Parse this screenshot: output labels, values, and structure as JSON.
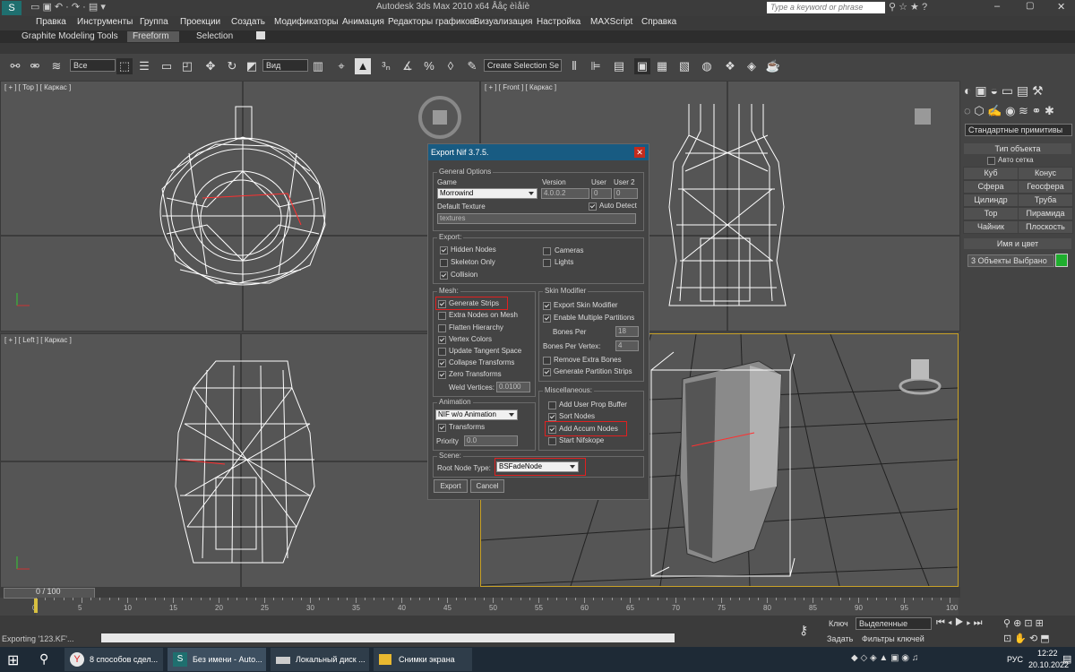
{
  "app": {
    "title": "Autodesk 3ds Max 2010 x64       Ååç èìåíè",
    "search_placeholder": "Type a keyword or phrase"
  },
  "menu": [
    "Правка",
    "Инструменты",
    "Группа",
    "Проекции",
    "Создать",
    "Модификаторы",
    "Анимация",
    "Редакторы графиков",
    "Визуализация",
    "Настройка",
    "MAXScript",
    "Справка"
  ],
  "ribbon_tabs": [
    "Graphite Modeling Tools",
    "Freeform",
    "Selection"
  ],
  "toolbar": {
    "select_filter": "Все",
    "ref_coord": "Вид",
    "selection_set": "Create Selection Se"
  },
  "viewports": {
    "top": "[ + ] [ Top ] [ Каркас ]",
    "front": "[ + ] [ Front ] [ Каркас ]",
    "left": "[ + ] [ Left ] [ Каркас ]"
  },
  "cmd_panel": {
    "category": "Стандартные примитивы",
    "object_type_header": "Тип объекта",
    "autogrid": "Авто сетка",
    "buttons": [
      "Куб",
      "Конус",
      "Сфера",
      "Геосфера",
      "Цилиндр",
      "Труба",
      "Тор",
      "Пирамида",
      "Чайник",
      "Плоскость"
    ],
    "name_header": "Имя и цвет",
    "name_value": "3 Объекты Выбрано"
  },
  "dialog": {
    "title": "Export Nif 3.7.5.",
    "general": {
      "header": "General Options",
      "game_label": "Game",
      "game": "Morrowind",
      "version_label": "Version",
      "version": "4.0.0.2",
      "user_label": "User",
      "user": "0",
      "user2_label": "User 2",
      "user2": "0",
      "auto_detect": "Auto Detect",
      "default_texture_label": "Default Texture",
      "default_texture": "textures"
    },
    "export": {
      "header": "Export:",
      "hidden_nodes": "Hidden Nodes",
      "skeleton_only": "Skeleton Only",
      "collision": "Collision",
      "cameras": "Cameras",
      "lights": "Lights"
    },
    "mesh": {
      "header": "Mesh:",
      "generate_strips": "Generate Strips",
      "extra_nodes": "Extra Nodes on Mesh",
      "flatten": "Flatten Hierarchy",
      "vertex_colors": "Vertex Colors",
      "tangent": "Update Tangent Space",
      "collapse": "Collapse Transforms",
      "zero": "Zero Transforms",
      "weld_label": "Weld Vertices:",
      "weld": "0.0100"
    },
    "skin": {
      "header": "Skin Modifier",
      "export_skin": "Export Skin Modifier",
      "multi_part": "Enable Multiple Partitions",
      "bones_per_label": "Bones Per",
      "bones_per": "18",
      "bones_vertex_label": "Bones Per Vertex:",
      "bones_vertex": "4",
      "remove_extra": "Remove Extra Bones",
      "gen_part_strips": "Generate Partition Strips"
    },
    "animation": {
      "header": "Animation",
      "type": "NIF w/o Animation",
      "transforms": "Transforms",
      "priority_label": "Priority",
      "priority": "0.0"
    },
    "misc": {
      "header": "Miscellaneous:",
      "user_prop": "Add User Prop Buffer",
      "sort_nodes": "Sort Nodes",
      "accum": "Add Accum Nodes",
      "nifskope": "Start Nifskope"
    },
    "scene": {
      "header": "Scene:",
      "root_label": "Root Node Type:",
      "root": "BSFadeNode"
    },
    "export_btn": "Export",
    "cancel_btn": "Cancel"
  },
  "timeline": {
    "frame": "0 / 100",
    "ticks": [
      "0",
      "5",
      "10",
      "15",
      "20",
      "25",
      "30",
      "35",
      "40",
      "45",
      "50",
      "55",
      "60",
      "65",
      "70",
      "75",
      "80",
      "85",
      "90",
      "95",
      "100"
    ]
  },
  "status": {
    "text": "Exporting '123.KF'...",
    "key_label": "Ключ",
    "key_mode": "Выделенные",
    "set_label": "Задать",
    "filters": "Фильтры ключей"
  },
  "taskbar": {
    "items": [
      "8 способов сдел...",
      "Без имени - Auto...",
      "Локальный диск ...",
      "Снимки экрана"
    ],
    "lang": "РУС",
    "time": "12:22",
    "date": "20.10.2022"
  },
  "colors": {
    "dialog_title": "#185b82",
    "highlight_box": "#e02020",
    "active_viewport": "#c9a227"
  }
}
